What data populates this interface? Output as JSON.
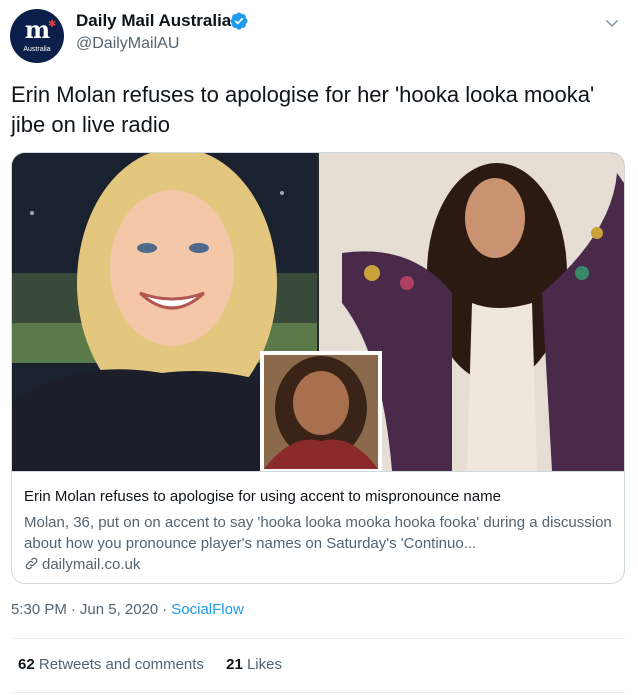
{
  "account": {
    "display_name": "Daily Mail Australia",
    "handle": "@DailyMailAU",
    "avatar_logo": "m",
    "avatar_sub": "Australia",
    "verified": true
  },
  "tweet": {
    "text": "Erin Molan refuses to apologise for her 'hooka looka mooka' jibe on live radio"
  },
  "card": {
    "title": "Erin Molan refuses to apologise for using accent to mispronounce name",
    "description": "Molan, 36, put on on accent to say 'hooka looka mooka hooka fooka' during a discussion about how you pronounce player's names on Saturday's 'Continuo...",
    "domain": "dailymail.co.uk"
  },
  "meta": {
    "time": "5:30 PM",
    "date": "Jun 5, 2020",
    "source": "SocialFlow",
    "separator": "·"
  },
  "stats": {
    "retweets_count": "62",
    "retweets_label": "Retweets and comments",
    "likes_count": "21",
    "likes_label": "Likes"
  },
  "colors": {
    "accent": "#1d9bf0",
    "text_primary": "#0f1419",
    "text_secondary": "#536471",
    "border": "#cfd9de"
  },
  "icons": {
    "verified": "verified-badge-icon",
    "menu": "chevron-down-icon",
    "link": "link-icon"
  }
}
